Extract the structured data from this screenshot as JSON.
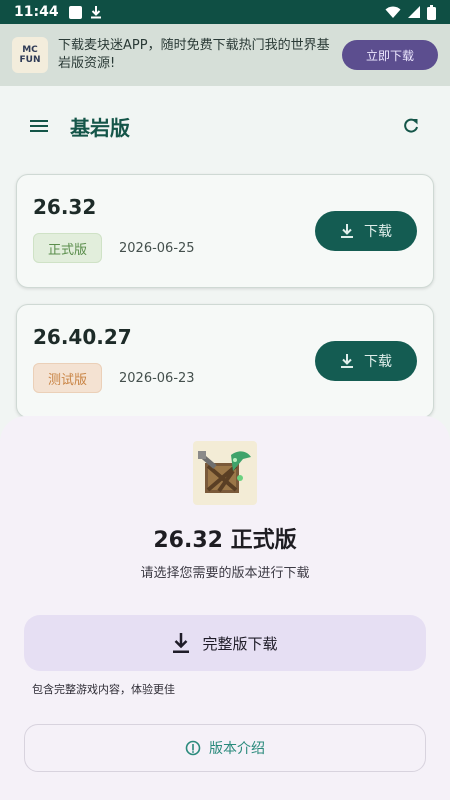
{
  "status_bar": {
    "time": "11:44"
  },
  "banner": {
    "logo_line1": "MC",
    "logo_line2": "FUN",
    "text": "下载麦块迷APP，随时免费下载热门我的世界基岩版资源!",
    "button_label": "立即下载"
  },
  "appbar": {
    "title": "基岩版"
  },
  "versions": [
    {
      "version": "26.32",
      "tag": "正式版",
      "date": "2026-06-25",
      "download_label": "下载"
    },
    {
      "version": "26.40.27",
      "tag": "测试版",
      "date": "2026-06-23",
      "download_label": "下载"
    }
  ],
  "sheet": {
    "title": "26.32 正式版",
    "subtitle": "请选择您需要的版本进行下载",
    "full_download_label": "完整版下载",
    "full_download_note": "包含完整游戏内容，体验更佳",
    "intro_label": "版本介绍"
  },
  "colors": {
    "primary": "#145c52",
    "status_bar": "#0f4f44",
    "banner_button": "#5c4e8f",
    "sheet_bg": "#f5f1f8",
    "full_button_bg": "#e6dff3",
    "stable_tag": "#5a8d4b",
    "beta_tag": "#c98546"
  }
}
